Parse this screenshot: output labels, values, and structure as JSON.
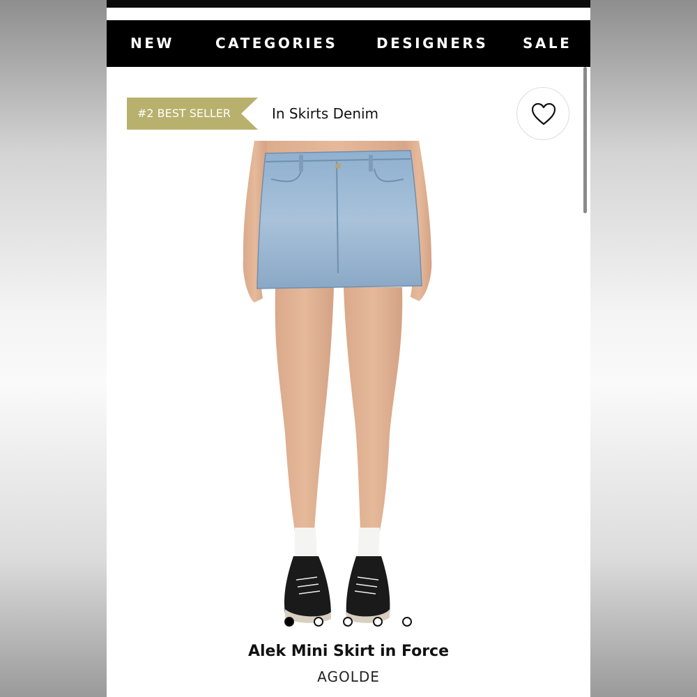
{
  "nav": {
    "items": [
      {
        "label": "NEW"
      },
      {
        "label": "CATEGORIES"
      },
      {
        "label": "DESIGNERS"
      },
      {
        "label": "SALE"
      }
    ]
  },
  "badge": {
    "label": "#2 BEST SELLER",
    "color": "#b8b06d"
  },
  "category": {
    "label": "In Skirts Denim"
  },
  "wishlist": {
    "icon": "heart-icon"
  },
  "product": {
    "image": "product-photo-denim-mini-skirt",
    "title": "Alek Mini Skirt in Force",
    "brand": "AGOLDE",
    "image_count": 5,
    "active_image": 1
  }
}
